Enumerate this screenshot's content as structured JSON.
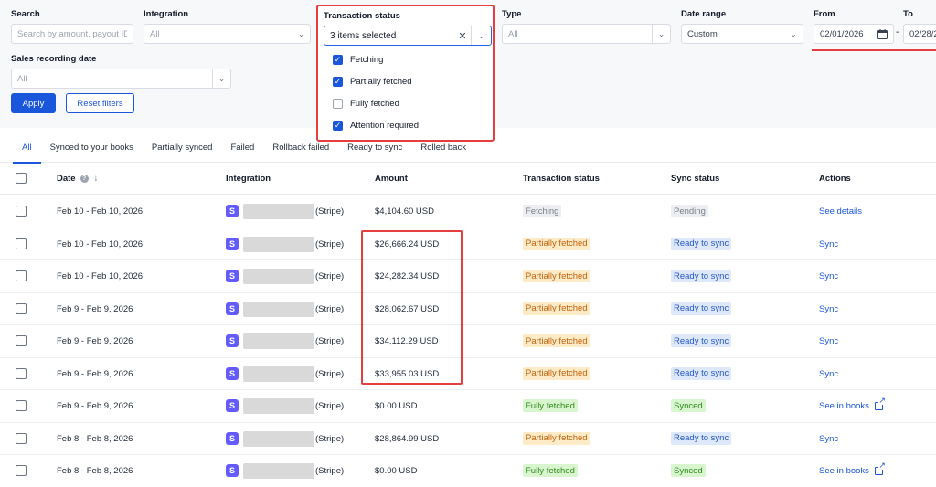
{
  "filters": {
    "search": {
      "label": "Search",
      "placeholder": "Search by amount, payout ID o"
    },
    "integration": {
      "label": "Integration",
      "value": "All"
    },
    "transaction_status": {
      "label": "Transaction status",
      "value": "3 items selected",
      "options": [
        {
          "label": "Fetching",
          "checked": true
        },
        {
          "label": "Partially fetched",
          "checked": true
        },
        {
          "label": "Fully fetched",
          "checked": false
        },
        {
          "label": "Attention required",
          "checked": true
        }
      ]
    },
    "type": {
      "label": "Type",
      "value": "All"
    },
    "date_range": {
      "label": "Date range",
      "value": "Custom"
    },
    "from": {
      "label": "From",
      "value": "02/01/2026"
    },
    "to": {
      "label": "To",
      "value": "02/28/2"
    },
    "date_separator": "-",
    "sales_recording_date": {
      "label": "Sales recording date",
      "value": "All"
    },
    "apply_label": "Apply",
    "reset_label": "Reset filters"
  },
  "tabs": [
    "All",
    "Synced to your books",
    "Partially synced",
    "Failed",
    "Rollback failed",
    "Ready to sync",
    "Rolled back"
  ],
  "table": {
    "headers": {
      "date": "Date",
      "integration": "Integration",
      "amount": "Amount",
      "transaction_status": "Transaction status",
      "sync_status": "Sync status",
      "actions": "Actions"
    },
    "rows": [
      {
        "date": "Feb 10 - Feb 10, 2026",
        "source": "(Stripe)",
        "amount": "$4,104.60 USD",
        "tx_status": "Fetching",
        "sync_status": "Pending",
        "action": "See details",
        "ext": false
      },
      {
        "date": "Feb 10 - Feb 10, 2026",
        "source": "(Stripe)",
        "amount": "$26,666.24 USD",
        "tx_status": "Partially fetched",
        "sync_status": "Ready to sync",
        "action": "Sync",
        "ext": false
      },
      {
        "date": "Feb 10 - Feb 10, 2026",
        "source": "(Stripe)",
        "amount": "$24,282.34 USD",
        "tx_status": "Partially fetched",
        "sync_status": "Ready to sync",
        "action": "Sync",
        "ext": false
      },
      {
        "date": "Feb 9 - Feb 9, 2026",
        "source": "(Stripe)",
        "amount": "$28,062.67 USD",
        "tx_status": "Partially fetched",
        "sync_status": "Ready to sync",
        "action": "Sync",
        "ext": false
      },
      {
        "date": "Feb 9 - Feb 9, 2026",
        "source": "(Stripe)",
        "amount": "$34,112.29 USD",
        "tx_status": "Partially fetched",
        "sync_status": "Ready to sync",
        "action": "Sync",
        "ext": false
      },
      {
        "date": "Feb 9 - Feb 9, 2026",
        "source": "(Stripe)",
        "amount": "$33,955.03 USD",
        "tx_status": "Partially fetched",
        "sync_status": "Ready to sync",
        "action": "Sync",
        "ext": false
      },
      {
        "date": "Feb 9 - Feb 9, 2026",
        "source": "(Stripe)",
        "amount": "$0.00 USD",
        "tx_status": "Fully fetched",
        "sync_status": "Synced",
        "action": "See in books",
        "ext": true
      },
      {
        "date": "Feb 8 - Feb 8, 2026",
        "source": "(Stripe)",
        "amount": "$28,864.99 USD",
        "tx_status": "Partially fetched",
        "sync_status": "Ready to sync",
        "action": "Sync",
        "ext": false
      },
      {
        "date": "Feb 8 - Feb 8, 2026",
        "source": "(Stripe)",
        "amount": "$0.00 USD",
        "tx_status": "Fully fetched",
        "sync_status": "Synced",
        "action": "See in books",
        "ext": true
      }
    ]
  },
  "badge_colors": {
    "Fetching": {
      "bg": "#eceef1",
      "fg": "#7a8089"
    },
    "Pending": {
      "bg": "#eceef1",
      "fg": "#7a8089"
    },
    "Partially fetched": {
      "bg": "#fdebc8",
      "fg": "#c2630a"
    },
    "Ready to sync": {
      "bg": "#dde8fb",
      "fg": "#2556c4"
    },
    "Fully fetched": {
      "bg": "#d8f5cf",
      "fg": "#2f8a1a"
    },
    "Synced": {
      "bg": "#d8f5cf",
      "fg": "#2f8a1a"
    }
  },
  "icons": {
    "stripe": "S",
    "date_info": "info-icon",
    "date_sort": "arrow-down-icon",
    "calendar": "calendar-icon"
  }
}
